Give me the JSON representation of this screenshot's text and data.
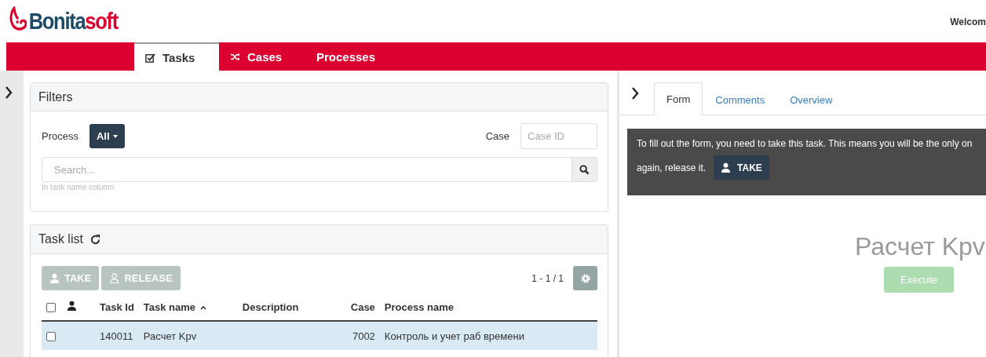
{
  "header": {
    "logo": [
      "Bonita",
      "soft"
    ],
    "welcome": "Welcom"
  },
  "nav": [
    {
      "label": "Tasks",
      "selected": true
    },
    {
      "label": "Cases",
      "selected": false
    },
    {
      "label": "Processes",
      "selected": false
    }
  ],
  "filters": {
    "title": "Filters",
    "process_label": "Process",
    "process_value": "All",
    "case_label": "Case",
    "case_placeholder": "Case ID",
    "search_placeholder": "Search...",
    "search_hint": "In task name column"
  },
  "task_list": {
    "title": "Task list",
    "buttons": [
      {
        "label": "TAKE",
        "disabled": true
      },
      {
        "label": "RELEASE",
        "disabled": true
      }
    ],
    "select_all_checked": false,
    "pagination": "1 - 1 / 1",
    "columns": [
      {
        "label": "Task Id",
        "sorted": false
      },
      {
        "label": "Task name",
        "sorted": true
      },
      {
        "label": "Description",
        "sorted": false
      },
      {
        "label": "Case",
        "sorted": false
      },
      {
        "label": "Process name",
        "sorted": false
      }
    ],
    "rows": [
      {
        "checked": false,
        "selected": true,
        "task_id": "140011",
        "task_name": "Расчет Kpv",
        "case": "7002",
        "process_name": "Контроль и учет раб времени"
      }
    ]
  },
  "detail": {
    "tabs": [
      {
        "label": "Form",
        "selected": true
      },
      {
        "label": "Comments",
        "selected": false
      },
      {
        "label": "Overview",
        "selected": false
      }
    ],
    "notice": "To fill out the form, you need to take this task. This means you will be the only on",
    "notice_tail": "again, release it.",
    "take_button": "TAKE",
    "form_title": "Расчет Kpv",
    "execute_button": {
      "label": "Execute",
      "disabled": true
    }
  }
}
